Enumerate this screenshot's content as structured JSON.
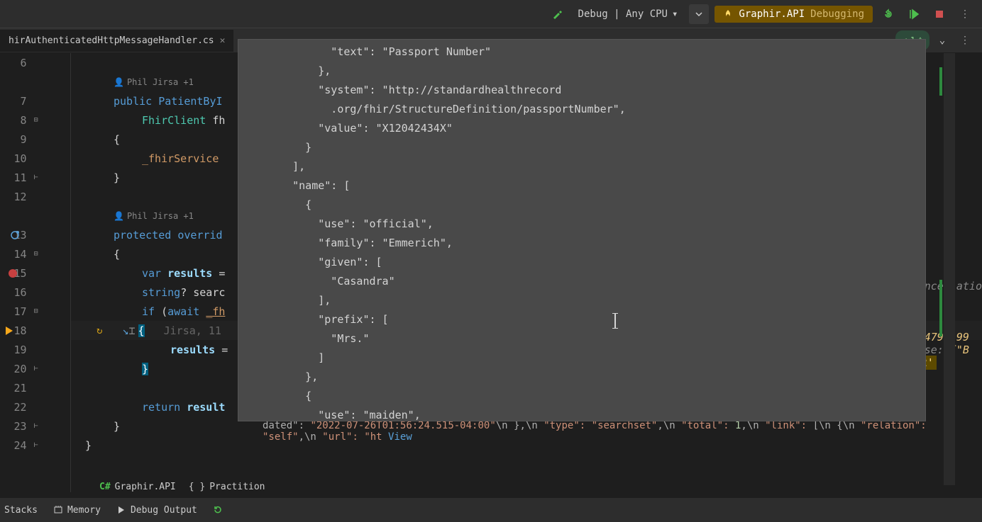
{
  "toolbar": {
    "config": "Debug | Any CPU",
    "project": "Graphir.API",
    "state": "Debugging"
  },
  "tabs": {
    "active_file": "hirAuthenticatedHttpMessageHandler.cs",
    "indicator_count": "1"
  },
  "codelens": {
    "author1": "Phil Jirsa +1",
    "author2": "Phil Jirsa +1"
  },
  "lines": {
    "6": "6",
    "7": "7",
    "8": "8",
    "9": "9",
    "10": "10",
    "11": "11",
    "12": "12",
    "13": "13",
    "14": "14",
    "15": "15",
    "16": "16",
    "17": "17",
    "18": "18",
    "19": "19",
    "20": "20",
    "21": "21",
    "22": "22",
    "23": "23",
    "24": "24"
  },
  "code": {
    "l7": "public PatientByI",
    "l8": "FhirClient fh",
    "l9_open": "{",
    "l10_field": "_fhirService",
    "l11_close": "}",
    "l13": "protected overrid",
    "l14_open": "{",
    "l15_var": "var",
    "l15_results": "results",
    "l15_eq": " =",
    "l16_string": "string",
    "l16_rest": "? searc",
    "l17_if": "if",
    "l17_await": " (await ",
    "l17_fh": "_fh",
    "l18_open": "{",
    "l18_hint": "   Jirsa, 11",
    "l19_results": "results",
    "l19_eq": " =",
    "l20_close": "}",
    "l22_return": "return",
    "l22_result": " result",
    "l23_close": "}",
    "l24_close": "}"
  },
  "popup": {
    "j1": "          \"text\": \"Passport Number\"",
    "j2": "        },",
    "j3": "        \"system\": \"http://standardhealthrecord",
    "j4": "          .org/fhir/StructureDefinition/passportNumber\",",
    "j5": "        \"value\": \"X12042434X\"",
    "j6": "      }",
    "j7": "    ],",
    "j8": "    \"name\": [",
    "j9": "      {",
    "j10": "        \"use\": \"official\",",
    "j11": "        \"family\": \"Emmerich\",",
    "j12": "        \"given\": [",
    "j13": "          \"Casandra\"",
    "j14": "        ],",
    "j15": "        \"prefix\": [",
    "j16": "          \"Mrs.\"",
    "j17": "        ]",
    "j18": "      },",
    "j19": "      {",
    "j20": "        \"use\": \"maiden\","
  },
  "inline": {
    "prefix": "dated\":",
    "date": "\"2022-07-26T01:56:24.515-04:00\"",
    "type_k": "\"type\":",
    "type_v": "\"searchset\"",
    "total_k": "\"total\":",
    "total_v": "1",
    "link_k": "\"link\":",
    "rel_k": "\"relation\":",
    "rel_v": "\"self\"",
    "url_k": "\"url\":",
    "url_v": "\"ht",
    "view": "View"
  },
  "right_peek": {
    "r1": "ancellatio",
    "r2a": "-4799-99",
    "r2b": "…",
    "r3a": "nse:  ",
    "r3b": "{\"B",
    "r4": "2'"
  },
  "bottom_tabs": {
    "t1": "Graphir.API",
    "t2": "Practition"
  },
  "status": {
    "stacks": "Stacks",
    "memory": "Memory",
    "debug_output": "Debug Output"
  }
}
